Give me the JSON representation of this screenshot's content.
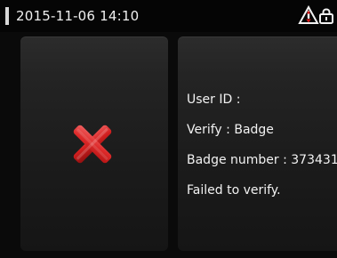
{
  "status_bar": {
    "datetime": "2015-11-06 14:10",
    "icons": [
      "warning-icon",
      "lock-icon"
    ]
  },
  "result": {
    "status_icon": "red-x-icon",
    "lines": {
      "user_id": "User ID :",
      "verify": "Verify : Badge",
      "badge_number": "Badge number : 373431",
      "message": "Failed to verify."
    }
  },
  "colors": {
    "background": "#0a0a0a",
    "panel": "#1f1f1f",
    "text": "#f2f2f2",
    "error_red": "#cc1a1a"
  }
}
